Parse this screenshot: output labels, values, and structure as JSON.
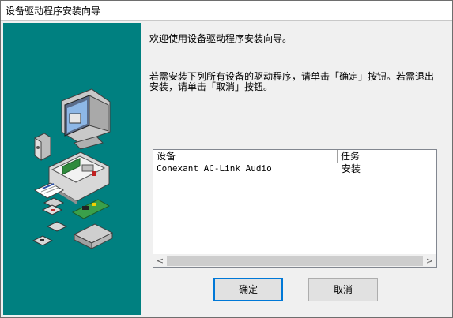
{
  "window": {
    "title": "设备驱动程序安装向导"
  },
  "content": {
    "welcome": "欢迎使用设备驱动程序安装向导。",
    "instructions": "若需安装下列所有设备的驱动程序，请单击「确定」按钮。若需退出安装，请单击「取消」按钮。"
  },
  "device_list": {
    "columns": [
      "设备",
      "任务"
    ],
    "rows": [
      {
        "device": "Conexant AC-Link Audio",
        "task": "安装"
      }
    ]
  },
  "buttons": {
    "ok": "确定",
    "cancel": "取消"
  },
  "colors": {
    "side_panel": "#008080",
    "accent": "#0078d7"
  }
}
